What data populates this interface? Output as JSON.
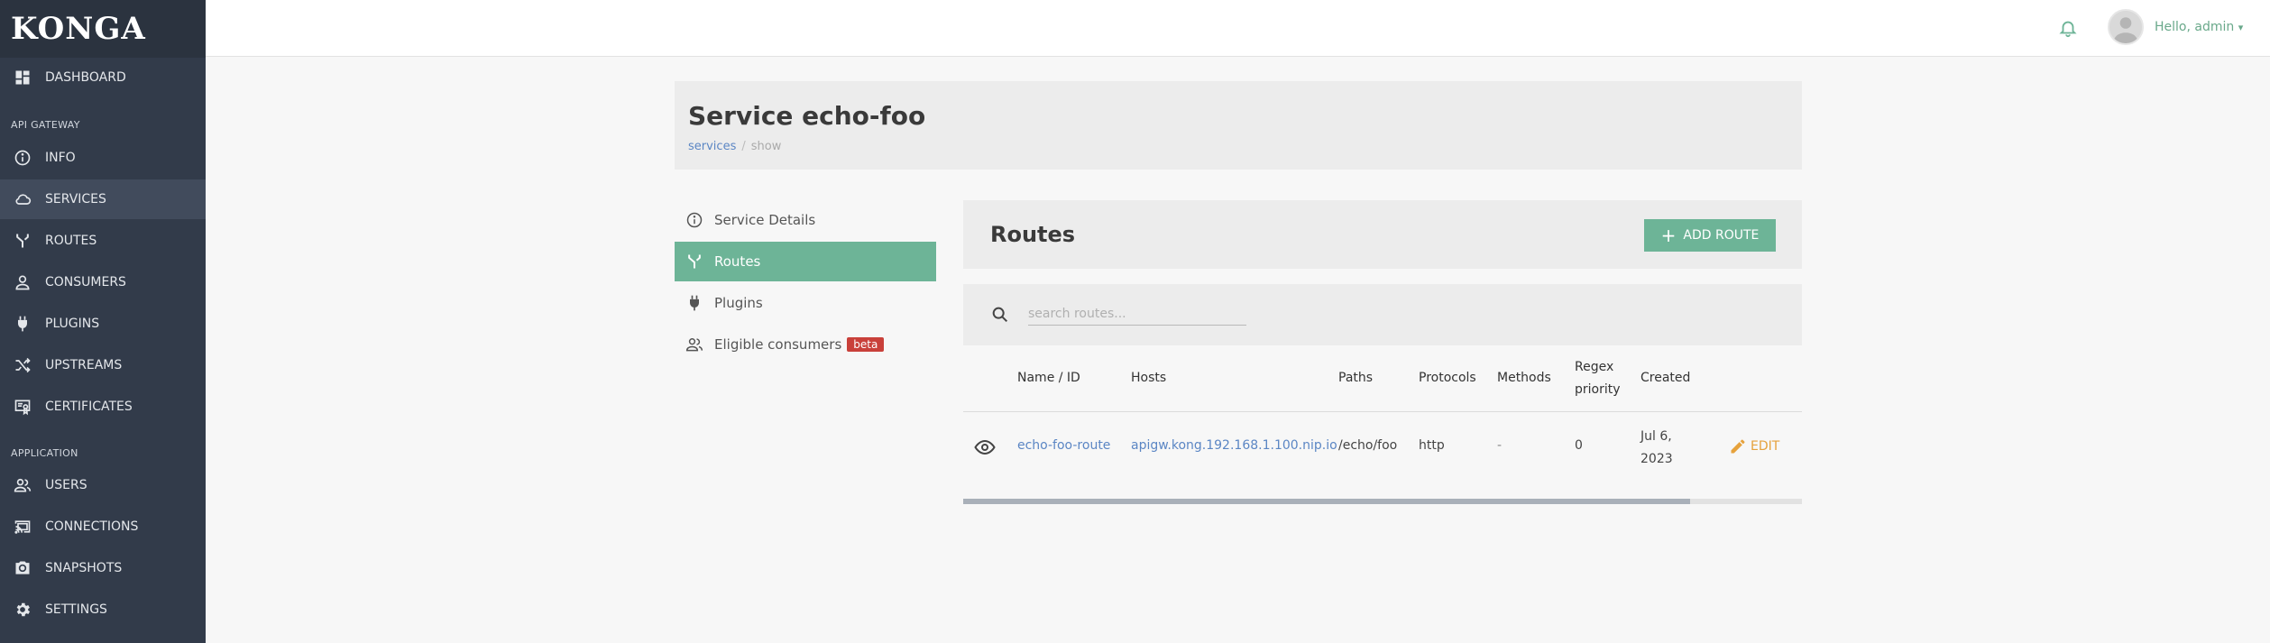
{
  "brand": "KONGA",
  "sidebar": {
    "dashboard": "DASHBOARD",
    "section_api": "API GATEWAY",
    "info": "INFO",
    "services": "SERVICES",
    "routes": "ROUTES",
    "consumers": "CONSUMERS",
    "plugins": "PLUGINS",
    "upstreams": "UPSTREAMS",
    "certificates": "CERTIFICATES",
    "section_app": "APPLICATION",
    "users": "USERS",
    "connections": "CONNECTIONS",
    "snapshots": "SNAPSHOTS",
    "settings": "SETTINGS"
  },
  "topbar": {
    "greeting": "Hello, admin",
    "caret": "▾"
  },
  "page": {
    "title": "Service echo-foo",
    "breadcrumb_link": "services",
    "breadcrumb_sep": "/",
    "breadcrumb_current": "show"
  },
  "service_menu": {
    "details": "Service Details",
    "routes": "Routes",
    "plugins": "Plugins",
    "eligible": "Eligible consumers",
    "beta": "beta"
  },
  "routes_panel": {
    "title": "Routes",
    "add_button": "ADD ROUTE",
    "add_plus": "+",
    "search_placeholder": "search routes..."
  },
  "table": {
    "headers": {
      "name": "Name / ID",
      "hosts": "Hosts",
      "paths": "Paths",
      "protocols": "Protocols",
      "methods": "Methods",
      "regex_line1": "Regex",
      "regex_line2": "priority",
      "created": "Created"
    },
    "rows": [
      {
        "name": "echo-foo-route",
        "hosts": "apigw.kong.192.168.1.100.nip.io",
        "paths": "/echo/foo",
        "protocols": "http",
        "methods": "-",
        "regex_priority": "0",
        "created_line1": "Jul 6,",
        "created_line2": "2023",
        "edit": "EDIT"
      }
    ]
  },
  "colors": {
    "sidebar_bg": "#323b4a",
    "accent_green": "#6db497",
    "link_blue": "#5b86c4",
    "edit_orange": "#e6a23c",
    "beta_red": "#c9403a"
  },
  "horizontal_scroll_fraction": 0.87
}
